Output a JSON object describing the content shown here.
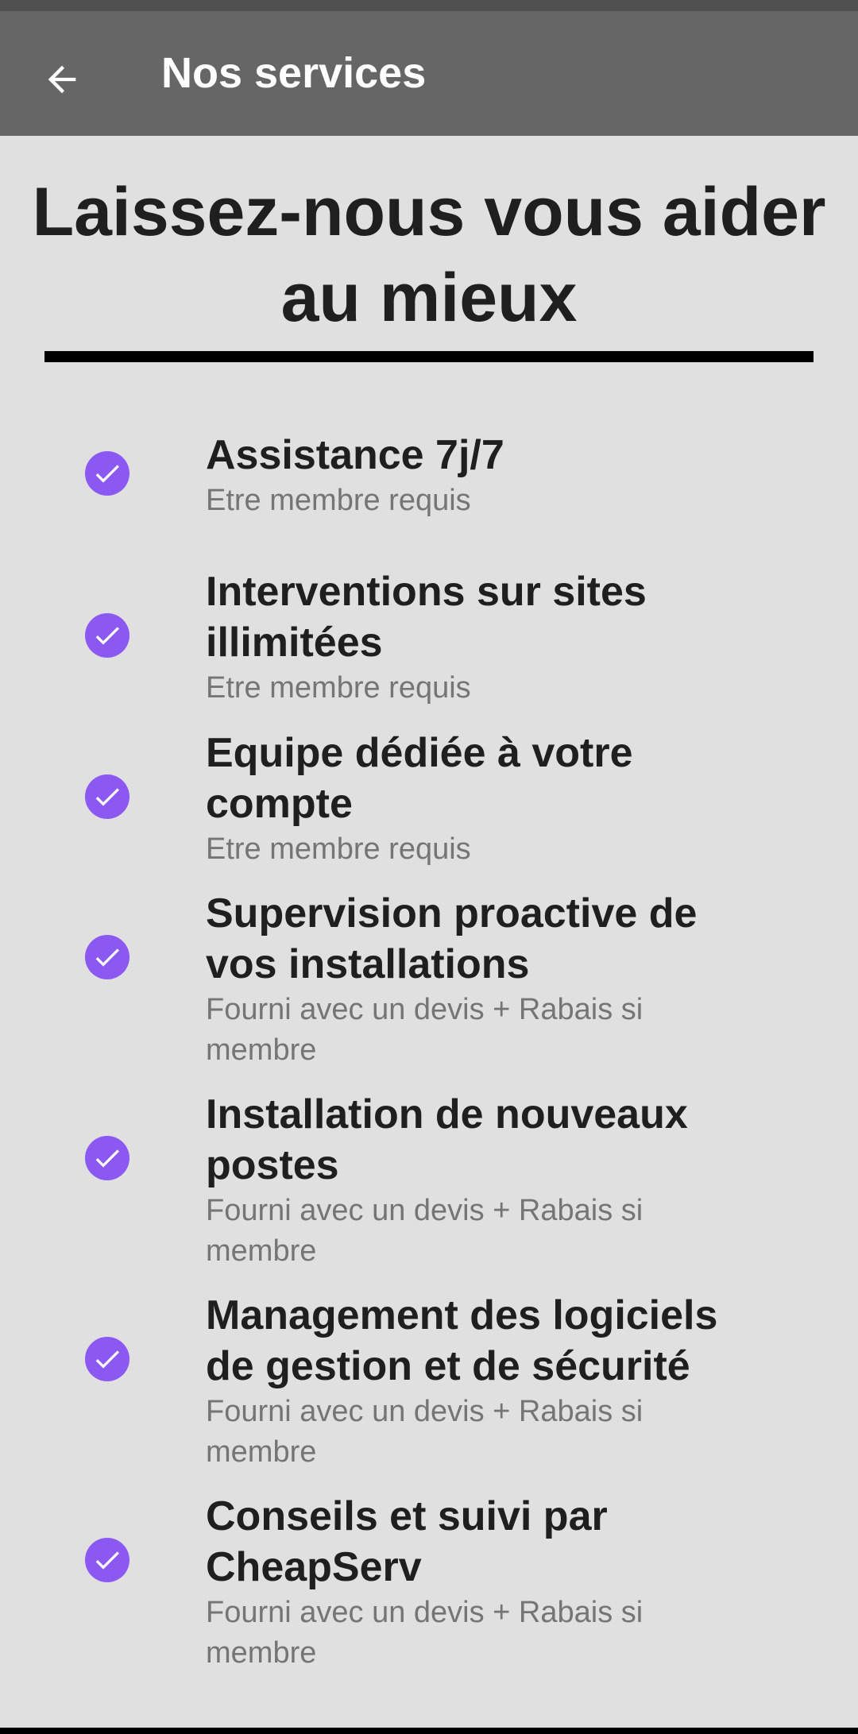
{
  "app_bar": {
    "back_icon": "arrow-left-icon",
    "title": "Nos services"
  },
  "headline": "Laissez-nous vous aider au mieux",
  "colors": {
    "app_bar": "#666666",
    "background": "#e0e0e0",
    "accent": "#8c58f2"
  },
  "services": [
    {
      "icon": "check-circle-icon",
      "title": "Assistance 7j/7",
      "subtitle": "Etre membre requis"
    },
    {
      "icon": "check-circle-icon",
      "title": "Interventions sur sites illimitées",
      "subtitle": "Etre membre requis"
    },
    {
      "icon": "check-circle-icon",
      "title": "Equipe dédiée à votre compte",
      "subtitle": "Etre membre requis"
    },
    {
      "icon": "check-circle-icon",
      "title": "Supervision proactive de vos installations",
      "subtitle": "Fourni avec un devis + Rabais si membre"
    },
    {
      "icon": "check-circle-icon",
      "title": "Installation de nouveaux postes",
      "subtitle": "Fourni avec un devis + Rabais si membre"
    },
    {
      "icon": "check-circle-icon",
      "title": "Management des logiciels de gestion et de sécurité",
      "subtitle": "Fourni avec un devis + Rabais si membre"
    },
    {
      "icon": "check-circle-icon",
      "title": "Conseils et suivi par CheapServ",
      "subtitle": "Fourni avec un devis + Rabais si membre"
    }
  ]
}
